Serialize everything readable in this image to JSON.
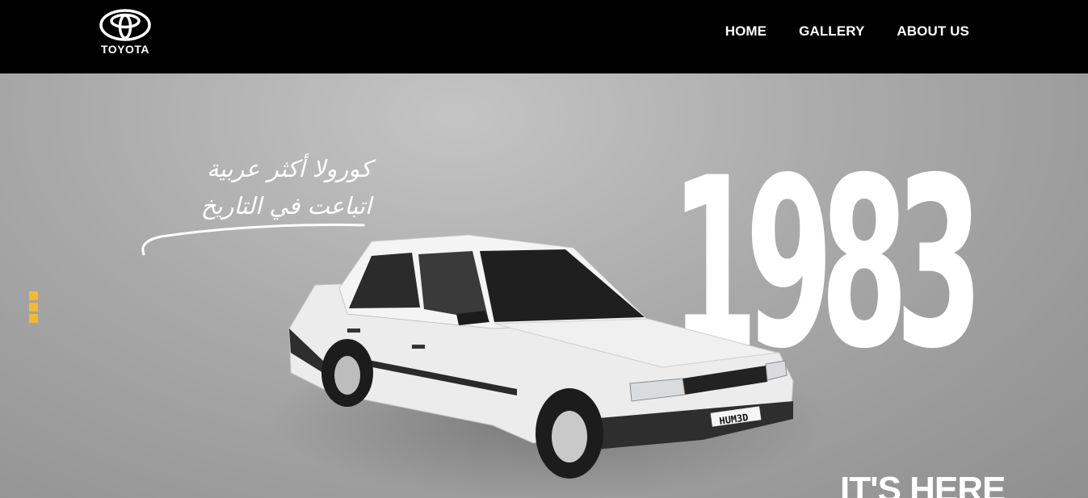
{
  "header": {
    "logo_text": "TOYOTA",
    "nav": [
      {
        "label": "HOME"
      },
      {
        "label": "GALLERY"
      },
      {
        "label": "ABOUT US"
      }
    ]
  },
  "hero": {
    "arabic_line_1": "كورولا أكثر عربية",
    "arabic_line_2": "اتباعت في التاريخ",
    "year": "1983",
    "tagline": "IT'S HERE",
    "license_plate": "HUM3D",
    "accent_color": "#f5b82e",
    "background_color": "#a9a9a9"
  }
}
